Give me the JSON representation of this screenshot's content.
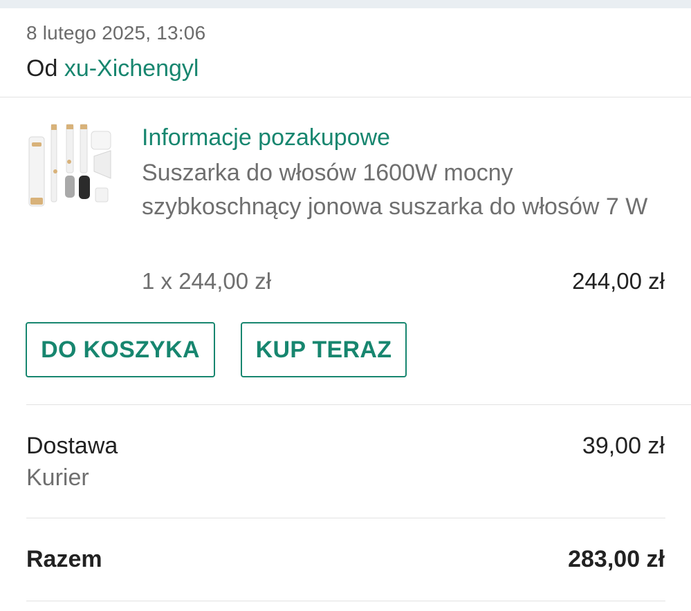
{
  "message": {
    "date": "8 lutego 2025, 13:06",
    "from_prefix": "Od",
    "seller_name": "xu-Xichengyl"
  },
  "product": {
    "section_title": "Informacje pozakupowe",
    "name": "Suszarka do włosów 1600W mocny szybkoschnący jonowa suszarka do włosów 7 W",
    "quantity_price": "1 x 244,00 zł",
    "line_total": "244,00 zł",
    "thumbnail_icon": "hair-dryer-set-image"
  },
  "actions": {
    "add_to_cart": "DO KOSZYKA",
    "buy_now": "KUP TERAZ"
  },
  "shipping": {
    "label": "Dostawa",
    "method": "Kurier",
    "price": "39,00 zł"
  },
  "total": {
    "label": "Razem",
    "price": "283,00 zł"
  },
  "colors": {
    "accent": "#17866f",
    "muted_text": "#6f6f6f",
    "divider": "#e2e2e2"
  }
}
